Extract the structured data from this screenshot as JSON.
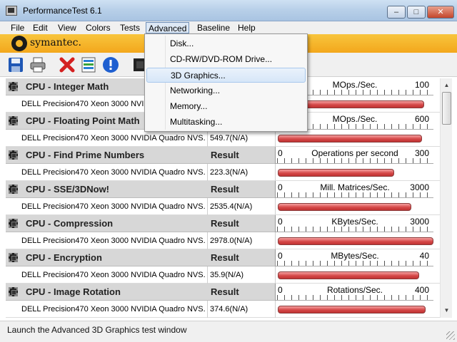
{
  "window": {
    "title": "PerformanceTest 6.1",
    "min": "–",
    "max": "□",
    "close": "✕"
  },
  "menu": [
    "File",
    "Edit",
    "View",
    "Colors",
    "Tests",
    "Advanced",
    "Baseline",
    "Help"
  ],
  "brand": {
    "name": "symantec."
  },
  "toolbar": {
    "icons": [
      "save-icon",
      "print-icon",
      "delete-icon",
      "list-icon",
      "info-icon",
      "chip-icon"
    ]
  },
  "dropdown": {
    "items": [
      "Disk...",
      "CD-RW/DVD-ROM Drive...",
      "3D Graphics...",
      "Networking...",
      "Memory...",
      "Multitasking..."
    ],
    "highlighted": 2
  },
  "result_label": "Result",
  "tests": [
    {
      "name": "CPU - Integer Math",
      "system": "DELL Precision470 Xeon 3000 NVIDIA Quadro NVS...",
      "result": "",
      "min": "0",
      "unit": "MOps./Sec.",
      "max": "100",
      "bar": 0.93
    },
    {
      "name": "CPU - Floating Point Math",
      "system": "DELL Precision470 Xeon 3000 NVIDIA Quadro NVS...",
      "result": "549.7(N/A)",
      "min": "0",
      "unit": "MOps./Sec.",
      "max": "600",
      "bar": 0.92
    },
    {
      "name": "CPU - Find Prime Numbers",
      "system": "DELL Precision470 Xeon 3000 NVIDIA Quadro NVS...",
      "result": "223.3(N/A)",
      "min": "0",
      "unit": "Operations per second",
      "max": "300",
      "bar": 0.74
    },
    {
      "name": "CPU - SSE/3DNow!",
      "system": "DELL Precision470 Xeon 3000 NVIDIA Quadro NVS...",
      "result": "2535.4(N/A)",
      "min": "0",
      "unit": "Mill. Matrices/Sec.",
      "max": "3000",
      "bar": 0.85
    },
    {
      "name": "CPU - Compression",
      "system": "DELL Precision470 Xeon 3000 NVIDIA Quadro NVS...",
      "result": "2978.0(N/A)",
      "min": "0",
      "unit": "KBytes/Sec.",
      "max": "3000",
      "bar": 0.99
    },
    {
      "name": "CPU - Encryption",
      "system": "DELL Precision470 Xeon 3000 NVIDIA Quadro NVS...",
      "result": "35.9(N/A)",
      "min": "0",
      "unit": "MBytes/Sec.",
      "max": "40",
      "bar": 0.9
    },
    {
      "name": "CPU - Image Rotation",
      "system": "DELL Precision470 Xeon 3000 NVIDIA Quadro NVS...",
      "result": "374.6(N/A)",
      "min": "0",
      "unit": "Rotations/Sec.",
      "max": "400",
      "bar": 0.94
    }
  ],
  "status": "Launch the Advanced 3D Graphics test window"
}
